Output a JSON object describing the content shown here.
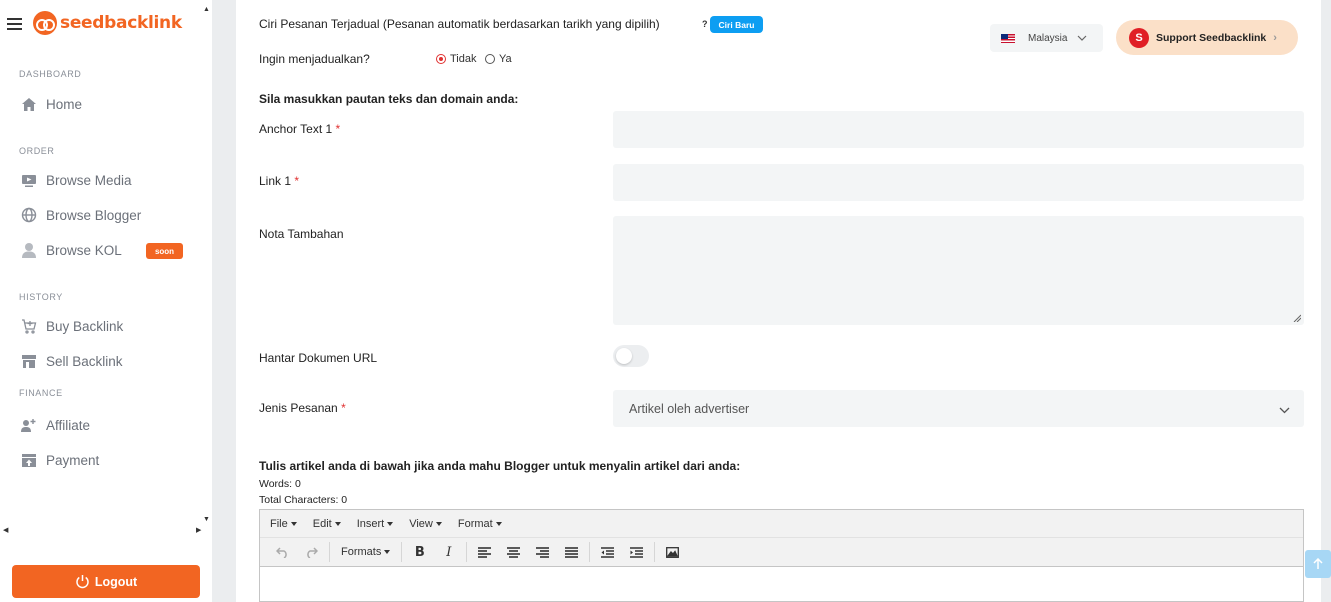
{
  "brand": {
    "name": "seedbacklink",
    "color": "#f26522"
  },
  "sidebar": {
    "sections": {
      "dashboard": "DASHBOARD",
      "order": "ORDER",
      "history": "HISTORY",
      "finance": "FINANCE"
    },
    "items": {
      "home": {
        "label": "Home",
        "icon": "home-icon"
      },
      "browse_media": {
        "label": "Browse Media",
        "icon": "media-icon"
      },
      "browse_blogger": {
        "label": "Browse Blogger",
        "icon": "globe-icon"
      },
      "browse_kol": {
        "label": "Browse KOL",
        "icon": "person-icon",
        "badge": "soon"
      },
      "buy_backlink": {
        "label": "Buy Backlink",
        "icon": "cart-icon"
      },
      "sell_backlink": {
        "label": "Sell Backlink",
        "icon": "store-icon"
      },
      "affiliate": {
        "label": "Affiliate",
        "icon": "users-plus-icon"
      },
      "payment": {
        "label": "Payment",
        "icon": "wallet-icon"
      }
    },
    "logout_label": "Logout"
  },
  "header": {
    "language": "Malaysia",
    "support_label": "Support Seedbacklink",
    "support_icon_letter": "S"
  },
  "form": {
    "schedule_feature_label": "Ciri Pesanan Terjadual (Pesanan automatik berdasarkan tarikh yang dipilih)",
    "help_mark": "?",
    "new_badge": "Ciri Baru",
    "schedule_question": "Ingin menjadualkan?",
    "radio_no": "Tidak",
    "radio_yes": "Ya",
    "selected": "Tidak",
    "links_instruction": "Sila masukkan pautan teks dan domain anda:",
    "anchor_label": "Anchor Text 1",
    "anchor_value": "",
    "link_label": "Link 1",
    "link_value": "",
    "required_mark": "*",
    "notes_label": "Nota Tambahan",
    "notes_value": "",
    "doc_url_label": "Hantar Dokumen URL",
    "doc_url_enabled": false,
    "order_type_label": "Jenis Pesanan",
    "order_type_value": "Artikel oleh advertiser",
    "article_instruction": "Tulis artikel anda di bawah jika anda mahu Blogger untuk menyalin artikel dari anda:",
    "words_count": "Words: 0",
    "chars_count": "Total Characters: 0"
  },
  "editor": {
    "menus": [
      "File",
      "Edit",
      "Insert",
      "View",
      "Format"
    ],
    "formats_label": "Formats",
    "bold": "B",
    "italic": "I"
  }
}
